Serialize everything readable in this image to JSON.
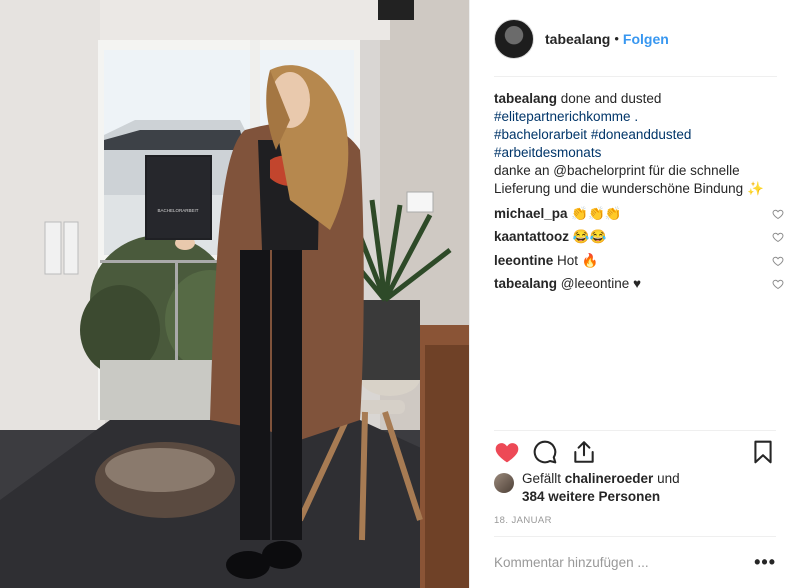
{
  "post": {
    "author": "tabealang",
    "follow_label": "Folgen",
    "separator": "•"
  },
  "caption": {
    "user": "tabealang",
    "text": " done and dusted",
    "tags": [
      "#elitepartnerichkomme .",
      "#bachelorarbeit #doneanddusted",
      "#arbeitdesmonats"
    ],
    "thanks_line1": "danke an @bachelorprint für die schnelle",
    "thanks_line2": "Lieferung und die wunderschöne Bindung ✨"
  },
  "comments": [
    {
      "user": "michael_pa",
      "text": " 👏👏👏"
    },
    {
      "user": "kaantattooz",
      "text": " 😂😂"
    },
    {
      "user": "leeontine",
      "text": " Hot 🔥"
    },
    {
      "user": "tabealang",
      "text": " @leeontine ♥"
    }
  ],
  "likes": {
    "line1_prefix": "Gefällt ",
    "liker": "chalineroeder",
    "line1_suffix": " und",
    "line2": "384 weitere Personen"
  },
  "date": "18. JANUAR",
  "comment_box": {
    "placeholder": "Kommentar hinzufügen ..."
  },
  "more_label": "•••",
  "photo": {
    "book_title": "BACHELORARBEIT"
  },
  "colors": {
    "like_red": "#ed4956",
    "link_blue": "#3897f0",
    "tag_blue": "#003569"
  }
}
